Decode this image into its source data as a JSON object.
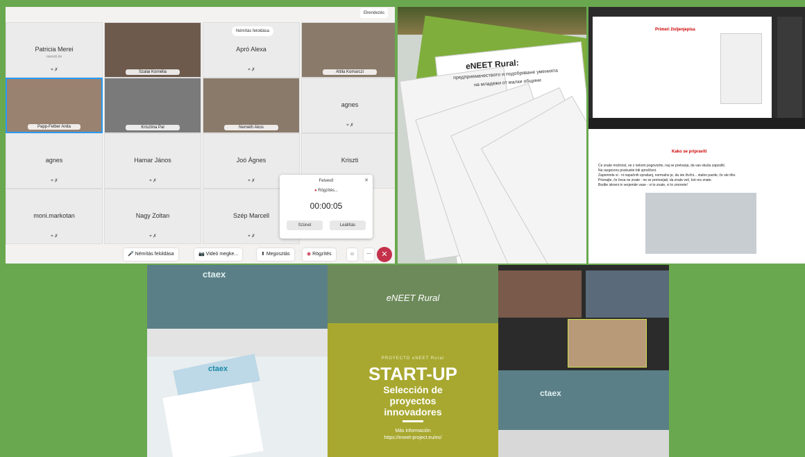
{
  "call": {
    "top_button": "Elrendezés",
    "unmute_chip": "Némítás feloldása",
    "tiles": [
      {
        "name": "Patricia Merei",
        "sub": "rawsoli.de"
      },
      {
        "name": "Szalai Kornélia"
      },
      {
        "name": "Apró Alexa"
      },
      {
        "name": "Attila Komarczi"
      },
      {
        "name": "Papp-Felber Anita"
      },
      {
        "name": "Krisztina Pal"
      },
      {
        "name": "Nemeth Akos"
      },
      {
        "name": "agnes"
      },
      {
        "name": "agnes"
      },
      {
        "name": "Hamar János"
      },
      {
        "name": "Joó Ágnes"
      },
      {
        "name": "Kriszti"
      },
      {
        "name": "moni.markotan"
      },
      {
        "name": "Nagy Zoltan"
      },
      {
        "name": "Szép Marcell"
      }
    ],
    "recorder": {
      "title": "Felvevő",
      "status": "Rögzítés...",
      "time": "00:00:05",
      "pause": "Szünet",
      "stop": "Leállítás"
    },
    "toolbar": {
      "unmute": "Némítás feloldása",
      "video": "Videó megke...",
      "share": "Megosztás",
      "record": "Rögzítés"
    }
  },
  "docs": {
    "title": "eNEET Rural:",
    "line1": "предприемачеството и подобряване уменията",
    "line2": "на младежи от малки общини"
  },
  "slides": {
    "heading1": "Primeri življenjepisa",
    "heading2": "Kako se pripraviti",
    "body": [
      "Ce znate možnost, se z nekom pogovorite, naj se pretvarja, da vas skuša zaposliti.",
      "Na razgovoru poskusite biti sproščeni.",
      "Zapomnite si - ni napačnih vprašanj, normalno je, da ste živčni... stalno pazite, če ste tiho.",
      "Priznajte, če česa ne znate - ne se pretvarjati, da znate več, kot res znate.",
      "Bodite iskreni in verjemite vase - vi to znate, vi to zmorete!"
    ]
  },
  "meeting": {
    "brand": "ctaex"
  },
  "poster": {
    "brand": "eNEET Rural",
    "kicker": "PROYECTO eNEET Rural",
    "title": "START-UP",
    "line1": "Selección de",
    "line2": "proyectos",
    "line3": "innovadores",
    "more": "Más información",
    "url": "https://eneet-project.eu/es/"
  },
  "colors": {
    "background": "#6aa84f",
    "accent": "#c4314b"
  }
}
